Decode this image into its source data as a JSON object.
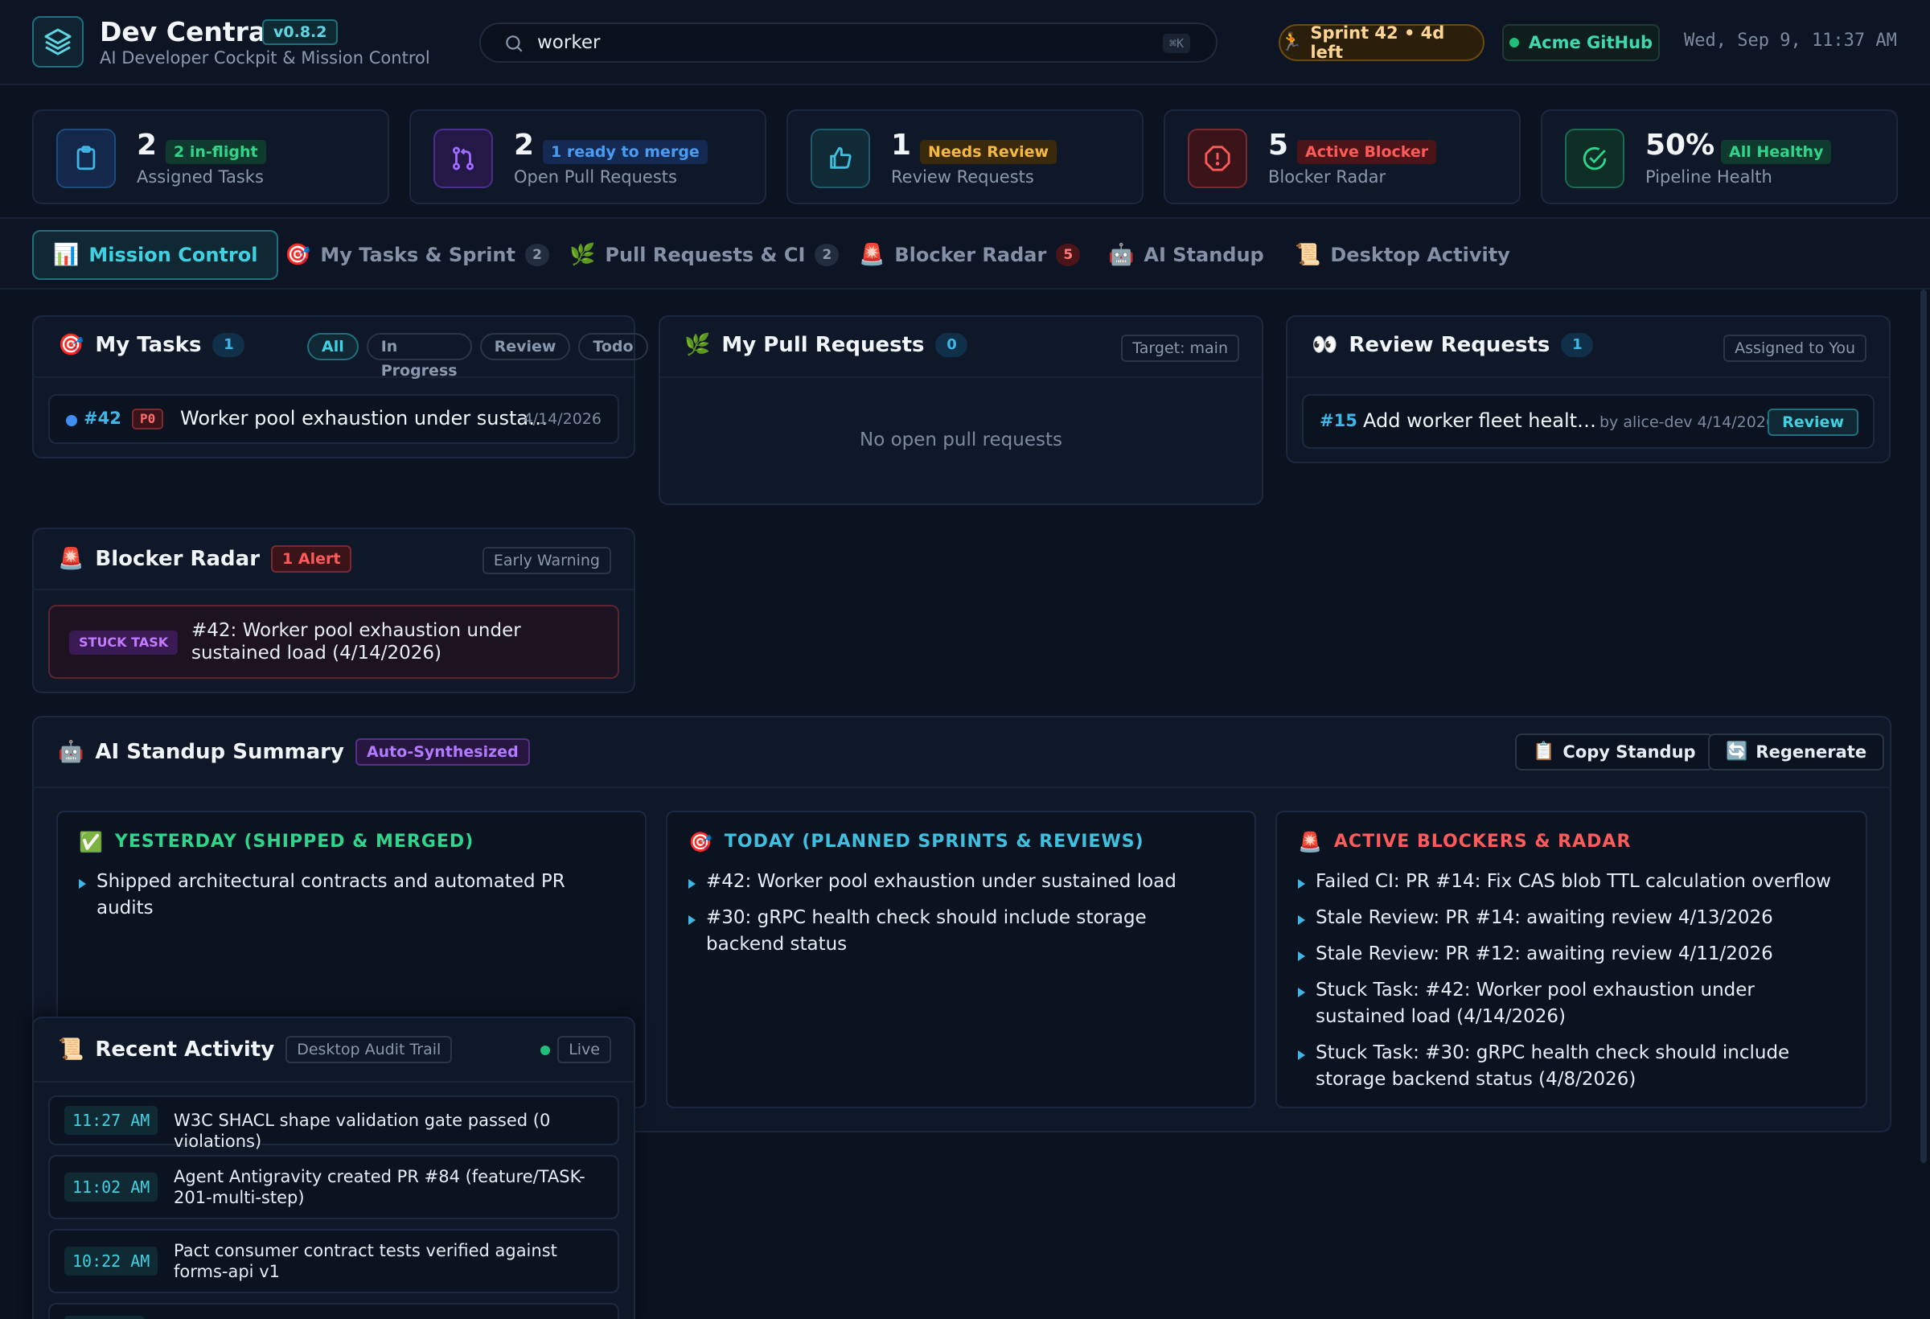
{
  "header": {
    "title": "Dev Central",
    "version": "v0.8.2",
    "subtitle": "AI Developer Cockpit & Mission Control",
    "search_value": "worker",
    "search_shortcut": "⌘K",
    "sprint": "Sprint 42 • 4d left",
    "github": "Acme GitHub",
    "clock": "Wed, Sep 9, 11:37 AM"
  },
  "stats": [
    {
      "num": "2",
      "badge": "2 in-flight",
      "label": "Assigned Tasks",
      "color": "#3fb6e6"
    },
    {
      "num": "2",
      "badge": "1 ready to merge",
      "label": "Open Pull Requests",
      "color": "#a06bff"
    },
    {
      "num": "1",
      "badge": "Needs Review",
      "label": "Review Requests",
      "color": "#f5b942"
    },
    {
      "num": "5",
      "badge": "Active Blocker",
      "label": "Blocker Radar",
      "color": "#ff5a5a"
    },
    {
      "num": "50%",
      "badge": "All Healthy",
      "label": "Pipeline Health",
      "color": "#2fd58a"
    }
  ],
  "tabs": [
    {
      "icon": "📊",
      "label": "Mission Control",
      "count": ""
    },
    {
      "icon": "🎯",
      "label": "My Tasks & Sprint",
      "count": "2"
    },
    {
      "icon": "🌿",
      "label": "Pull Requests & CI",
      "count": "2"
    },
    {
      "icon": "🚨",
      "label": "Blocker Radar",
      "count": "5"
    },
    {
      "icon": "🤖",
      "label": "AI Standup",
      "count": ""
    },
    {
      "icon": "📜",
      "label": "Desktop Activity",
      "count": ""
    }
  ],
  "my_tasks": {
    "title": "My Tasks",
    "count": "1",
    "filters": [
      "All",
      "In Progress",
      "Review",
      "Todo"
    ],
    "items": [
      {
        "id": "#42",
        "priority": "P0",
        "title": "Worker pool exhaustion under susta…",
        "date": "4/14/2026"
      }
    ]
  },
  "my_prs": {
    "title": "My Pull Requests",
    "count": "0",
    "tag": "Target: main",
    "empty": "No open pull requests"
  },
  "review_requests": {
    "title": "Review Requests",
    "count": "1",
    "tag": "Assigned to You",
    "items": [
      {
        "id": "#15",
        "title": "Add worker fleet healt…",
        "meta": "by alice-dev 4/14/2026",
        "action": "Review"
      }
    ]
  },
  "blocker_radar": {
    "title": "Blocker Radar",
    "alert": "1 Alert",
    "tag": "Early Warning",
    "items": [
      {
        "type": "STUCK TASK",
        "text": "#42: Worker pool exhaustion under sustained load (4/14/2026)"
      }
    ]
  },
  "standup": {
    "title": "AI Standup Summary",
    "badge": "Auto-Synthesized",
    "copy_label": "Copy Standup",
    "regen_label": "Regenerate",
    "yesterday": {
      "heading": "YESTERDAY (SHIPPED & MERGED)",
      "items": [
        "Shipped architectural contracts and automated PR audits"
      ]
    },
    "today": {
      "heading": "TODAY (PLANNED SPRINTS & REVIEWS)",
      "items": [
        "#42: Worker pool exhaustion under sustained load",
        "#30: gRPC health check should include storage backend status"
      ]
    },
    "blockers": {
      "heading": "ACTIVE BLOCKERS & RADAR",
      "items": [
        "Failed CI: PR #14: Fix CAS blob TTL calculation overflow",
        "Stale Review: PR #14: awaiting review 4/13/2026",
        "Stale Review: PR #12: awaiting review 4/11/2026",
        "Stuck Task: #42: Worker pool exhaustion under sustained load (4/14/2026)",
        "Stuck Task: #30: gRPC health check should include storage backend status (4/8/2026)"
      ]
    }
  },
  "activity": {
    "title": "Recent Activity",
    "tag": "Desktop Audit Trail",
    "live": "Live",
    "items": [
      {
        "time": "11:27 AM",
        "text": "W3C SHACL shape validation gate passed (0 violations)"
      },
      {
        "time": "11:02 AM",
        "text": "Agent Antigravity created PR #84 (feature/TASK-201-multi-step)"
      },
      {
        "time": "10:22 AM",
        "text": "Pact consumer contract tests verified against forms-api v1"
      }
    ]
  }
}
